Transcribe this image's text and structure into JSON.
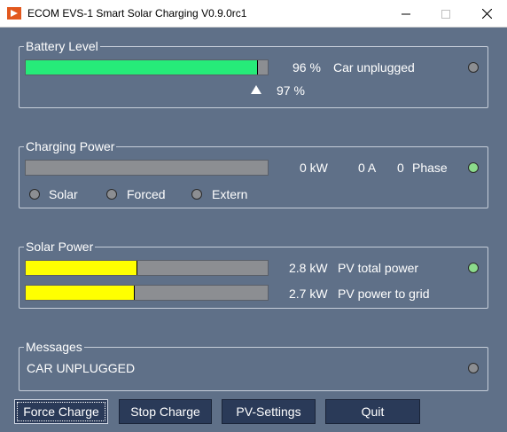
{
  "window": {
    "title": "ECOM EVS-1 Smart Solar Charging V0.9.0rc1",
    "icon": "ecom-app-icon",
    "controls": [
      "minimize-icon",
      "maximize-icon",
      "close-icon"
    ]
  },
  "battery": {
    "label": "Battery Level",
    "level_value": "96 %",
    "level_fraction": 0.96,
    "car_status": "Car unplugged",
    "target_value": "97 %",
    "indicator_on": false
  },
  "charging": {
    "label": "Charging Power",
    "power": "0 kW",
    "current": "0 A",
    "phase_count": "0",
    "phase_label": "Phase",
    "power_fraction": 0,
    "indicator_on": true,
    "modes": [
      "Solar",
      "Forced",
      "Extern"
    ]
  },
  "solar": {
    "label": "Solar Power",
    "rows": [
      {
        "value": "2.8 kW",
        "label": "PV total power",
        "fraction": 0.46
      },
      {
        "value": "2.7 kW",
        "label": "PV power to grid",
        "fraction": 0.45
      }
    ],
    "indicator_on": true
  },
  "messages": {
    "label": "Messages",
    "text": "CAR UNPLUGGED",
    "indicator_on": false
  },
  "buttons": {
    "force_charge": "Force Charge",
    "stop_charge": "Stop Charge",
    "pv_settings": "PV-Settings",
    "quit": "Quit"
  },
  "colors": {
    "background": "#5f7088",
    "battery_fill": "#26eb79",
    "solar_fill": "#ffff00",
    "indicator_on": "#8cdc8c",
    "indicator_off": "#8c8e92",
    "button": "#2a3a58"
  }
}
